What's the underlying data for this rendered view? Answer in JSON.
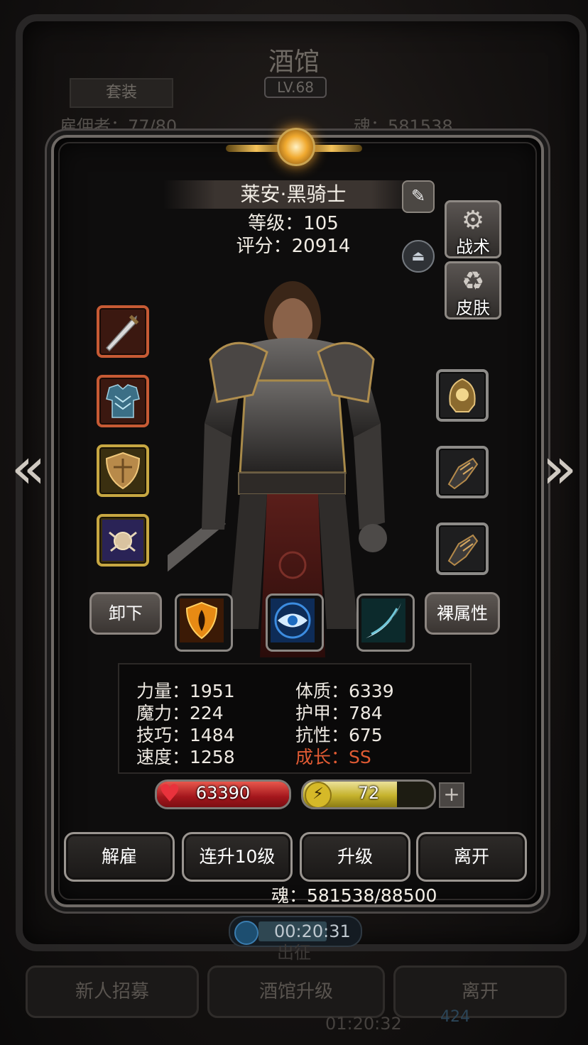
{
  "background": {
    "title": "酒馆",
    "level": "LV.68",
    "tab": "套装",
    "recruit_stat": "雇佣者：77/80",
    "soul_stat": "魂：581538",
    "timer": "00:20:31",
    "sub_label": "出征",
    "buttons": [
      "新人招募",
      "酒馆升级",
      "离开"
    ],
    "timer2": "01:20:32",
    "count2": "424"
  },
  "hero": {
    "name": "莱安·黑骑士",
    "level": "等级：105",
    "score": "评分：20914"
  },
  "side_buttons": {
    "tactics": "战术",
    "skin": "皮肤"
  },
  "equipment": {
    "left": [
      "sword-icon",
      "chest-armor-icon",
      "shield-icon",
      "amulet-icon"
    ],
    "right": [
      "helmet-icon",
      "gauntlet-icon",
      "gauntlet-icon"
    ]
  },
  "actions": {
    "unequip": "卸下",
    "base_attributes": "裸属性",
    "skills": [
      "flame-shield-icon",
      "eye-icon",
      "slash-icon"
    ]
  },
  "stats": {
    "strength": "力量：1951",
    "magic": "魔力：224",
    "skill": "技巧：1484",
    "speed": "速度：1258",
    "constitution": "体质：6339",
    "armor": "护甲：784",
    "resistance": "抗性：675",
    "growth": "成长：SS"
  },
  "bars": {
    "hp": "63390",
    "hp_fraction": 1.0,
    "energy": "72",
    "energy_fraction": 0.72,
    "add": "+"
  },
  "buttons": {
    "dismiss": "解雇",
    "level_up_10": "连升10级",
    "level_up": "升级",
    "leave": "离开"
  },
  "soul": "魂：581538/88500",
  "colors": {
    "hp": "#c0242a",
    "energy": "#c9b42e",
    "growth": "#e05a33"
  }
}
